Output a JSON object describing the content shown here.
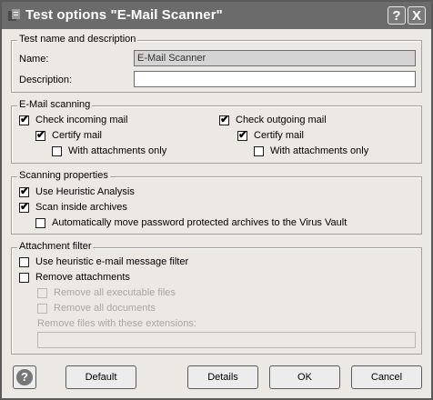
{
  "window": {
    "title": "Test options \"E-Mail Scanner\"",
    "help_glyph": "?",
    "close_glyph": "X",
    "icon": "app-icon"
  },
  "test_name": {
    "legend": "Test name and description",
    "name_label": "Name:",
    "name_value": "E-Mail Scanner",
    "description_label": "Description:",
    "description_value": ""
  },
  "email_scanning": {
    "legend": "E-Mail scanning",
    "incoming": {
      "label": "Check incoming mail",
      "checked": true
    },
    "incoming_certify": {
      "label": "Certify mail",
      "checked": true
    },
    "incoming_attachments": {
      "label": "With attachments only",
      "checked": false
    },
    "outgoing": {
      "label": "Check outgoing mail",
      "checked": true
    },
    "outgoing_certify": {
      "label": "Certify mail",
      "checked": true
    },
    "outgoing_attachments": {
      "label": "With attachments only",
      "checked": false
    }
  },
  "scanning_properties": {
    "legend": "Scanning properties",
    "heuristic": {
      "label": "Use Heuristic Analysis",
      "checked": true
    },
    "archives": {
      "label": "Scan inside archives",
      "checked": true
    },
    "move_password": {
      "label": "Automatically move password protected archives to the Virus Vault",
      "checked": false
    }
  },
  "attachment_filter": {
    "legend": "Attachment filter",
    "heuristic_filter": {
      "label": "Use heuristic e-mail message filter",
      "checked": false
    },
    "remove_attachments": {
      "label": "Remove attachments",
      "checked": false
    },
    "remove_executables": {
      "label": "Remove all executable files",
      "checked": false
    },
    "remove_documents": {
      "label": "Remove all documents",
      "checked": false
    },
    "extensions_label": "Remove files with these extensions:",
    "extensions_value": ""
  },
  "buttons": {
    "default": "Default",
    "details": "Details",
    "ok": "OK",
    "cancel": "Cancel",
    "help_glyph": "?"
  },
  "colors": {
    "titlebar": "#6b6b6b",
    "dialog_bg": "#ece9e4",
    "disabled_text": "#a6a6a6"
  }
}
